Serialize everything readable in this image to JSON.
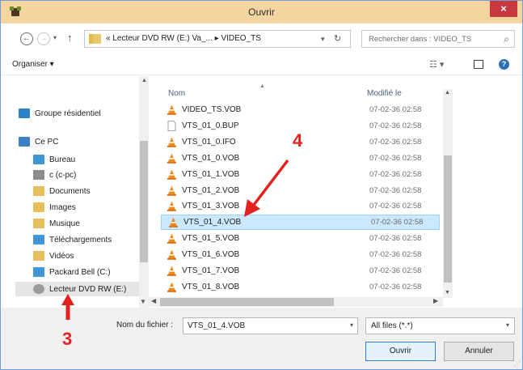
{
  "window": {
    "title": "Ouvrir",
    "close_symbol": "×",
    "app_icon": "app-icon"
  },
  "address": {
    "back_symbol": "←",
    "forward_symbol": "→",
    "dropdown_symbol": "▾",
    "up_symbol": "↑",
    "path": "« Lecteur DVD RW (E:) Va_...  ▸  VIDEO_TS",
    "refresh_symbol": "↻",
    "search_placeholder": "Rechercher dans : VIDEO_TS",
    "search_symbol": "⌕"
  },
  "toolbar": {
    "organize_label": "Organiser ▾",
    "view_symbol": "☷ ▾",
    "help_symbol": "?"
  },
  "navpane": {
    "items": [
      {
        "label": "Groupe résidentiel",
        "icon": "homegroup-icon",
        "color": "#2a83c8"
      },
      {
        "label": "Ce PC",
        "icon": "computer-icon",
        "color": "#3b7fc4"
      },
      {
        "label": "Bureau",
        "icon": "desktop-folder-icon",
        "color": "#3f95d6"
      },
      {
        "label": "c (c-pc)",
        "icon": "network-drive-icon",
        "color": "#8a8a8a"
      },
      {
        "label": "Documents",
        "icon": "documents-folder-icon",
        "color": "#e6bf5a"
      },
      {
        "label": "Images",
        "icon": "images-folder-icon",
        "color": "#e6bf5a"
      },
      {
        "label": "Musique",
        "icon": "music-folder-icon",
        "color": "#e6bf5a"
      },
      {
        "label": "Téléchargements",
        "icon": "downloads-folder-icon",
        "color": "#3f95d6"
      },
      {
        "label": "Vidéos",
        "icon": "videos-folder-icon",
        "color": "#e6bf5a"
      },
      {
        "label": "Packard Bell (C:)",
        "icon": "hard-drive-icon",
        "color": "#3f95d6"
      },
      {
        "label": "Lecteur DVD RW (E:)",
        "icon": "dvd-drive-icon",
        "color": "#9a9a9a"
      }
    ],
    "up_symbol": "▲",
    "down_symbol": "▼"
  },
  "files": {
    "col_name": "Nom",
    "col_modified": "Modifié le",
    "rows": [
      {
        "name": "VIDEO_TS.VOB",
        "date": "07-02-36 02:58",
        "icon": "vlc-cone-icon"
      },
      {
        "name": "VTS_01_0.BUP",
        "date": "07-02-36 02:58",
        "icon": "blank-file-icon"
      },
      {
        "name": "VTS_01_0.IFO",
        "date": "07-02-36 02:58",
        "icon": "vlc-cone-icon"
      },
      {
        "name": "VTS_01_0.VOB",
        "date": "07-02-36 02:58",
        "icon": "vlc-cone-icon"
      },
      {
        "name": "VTS_01_1.VOB",
        "date": "07-02-36 02:58",
        "icon": "vlc-cone-icon"
      },
      {
        "name": "VTS_01_2.VOB",
        "date": "07-02-36 02:58",
        "icon": "vlc-cone-icon"
      },
      {
        "name": "VTS_01_3.VOB",
        "date": "07-02-36 02:58",
        "icon": "vlc-cone-icon"
      },
      {
        "name": "VTS_01_4.VOB",
        "date": "07-02-36 02:58",
        "icon": "vlc-cone-icon",
        "selected": true
      },
      {
        "name": "VTS_01_5.VOB",
        "date": "07-02-36 02:58",
        "icon": "vlc-cone-icon"
      },
      {
        "name": "VTS_01_6.VOB",
        "date": "07-02-36 02:58",
        "icon": "vlc-cone-icon"
      },
      {
        "name": "VTS_01_7.VOB",
        "date": "07-02-36 02:58",
        "icon": "vlc-cone-icon"
      },
      {
        "name": "VTS_01_8.VOB",
        "date": "07-02-36 02:58",
        "icon": "vlc-cone-icon"
      }
    ]
  },
  "scroll": {
    "up_symbol": "▲",
    "down_symbol": "▼",
    "left_symbol": "◀",
    "right_symbol": "▶"
  },
  "footer": {
    "filename_label": "Nom du fichier :",
    "filename_value": "VTS_01_4.VOB",
    "dropdown_symbol": "▾",
    "filetype_value": "All files (*.*)",
    "open_label": "Ouvrir",
    "cancel_label": "Annuler",
    "grip_symbol": "⋰"
  },
  "annotations": {
    "label_3": "3",
    "label_4": "4",
    "arrow_color": "#e3211e"
  }
}
